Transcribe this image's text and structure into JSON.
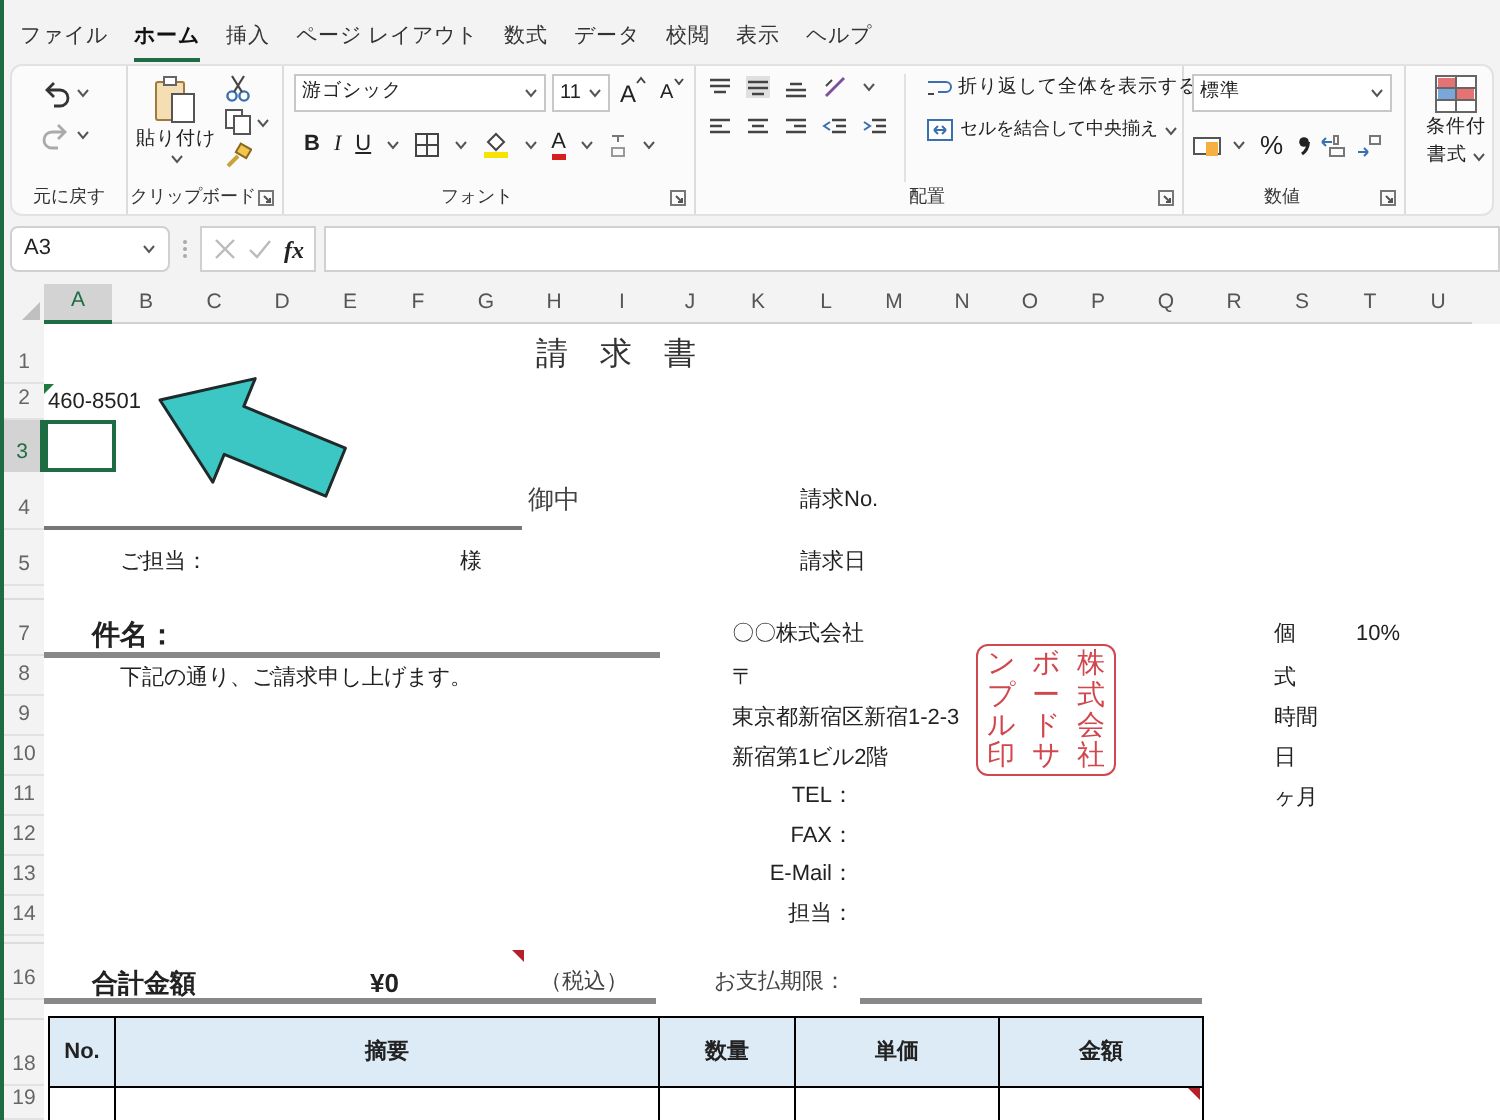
{
  "tabs": [
    {
      "label": "ファイル",
      "selected": false
    },
    {
      "label": "ホーム",
      "selected": true
    },
    {
      "label": "挿入",
      "selected": false
    },
    {
      "label": "ページ レイアウト",
      "selected": false
    },
    {
      "label": "数式",
      "selected": false
    },
    {
      "label": "データ",
      "selected": false
    },
    {
      "label": "校閲",
      "selected": false
    },
    {
      "label": "表示",
      "selected": false
    },
    {
      "label": "ヘルプ",
      "selected": false
    }
  ],
  "ribbon": {
    "undo_group": {
      "label": "元に戻す"
    },
    "clipboard_group": {
      "label": "クリップボード",
      "paste": "貼り付け"
    },
    "font_group": {
      "label": "フォント",
      "font_name": "游ゴシック",
      "font_size": "11",
      "grow_font": "A",
      "shrink_font": "A",
      "bold": "B",
      "italic": "I",
      "underline": "U",
      "font_color": "A"
    },
    "alignment_group": {
      "label": "配置",
      "wrap_text": "折り返して全体を表示する",
      "merge_center": "セルを結合して中央揃え"
    },
    "number_group": {
      "label": "数値",
      "number_format": "標準",
      "percent": "%"
    },
    "styles_group": {
      "conditional_format": "条件付",
      "format": "書式"
    }
  },
  "formula_bar": {
    "name_box": "A3",
    "fx": "fx"
  },
  "column_headers": [
    {
      "label": "A",
      "selected": true
    },
    {
      "label": "B",
      "selected": false
    },
    {
      "label": "C",
      "selected": false
    },
    {
      "label": "D",
      "selected": false
    },
    {
      "label": "E",
      "selected": false
    },
    {
      "label": "F",
      "selected": false
    },
    {
      "label": "G",
      "selected": false
    },
    {
      "label": "H",
      "selected": false
    },
    {
      "label": "I",
      "selected": false
    },
    {
      "label": "J",
      "selected": false
    },
    {
      "label": "K",
      "selected": false
    },
    {
      "label": "L",
      "selected": false
    },
    {
      "label": "M",
      "selected": false
    },
    {
      "label": "N",
      "selected": false
    },
    {
      "label": "O",
      "selected": false
    },
    {
      "label": "P",
      "selected": false
    },
    {
      "label": "Q",
      "selected": false
    },
    {
      "label": "R",
      "selected": false
    },
    {
      "label": "S",
      "selected": false
    },
    {
      "label": "T",
      "selected": false
    },
    {
      "label": "U",
      "selected": false
    }
  ],
  "row_headers": [
    {
      "label": "1",
      "selected": false
    },
    {
      "label": "2",
      "selected": false
    },
    {
      "label": "3",
      "selected": true
    },
    {
      "label": "4",
      "selected": false
    },
    {
      "label": "5",
      "selected": false
    },
    {
      "label": "7",
      "selected": false
    },
    {
      "label": "8",
      "selected": false
    },
    {
      "label": "9",
      "selected": false
    },
    {
      "label": "10",
      "selected": false
    },
    {
      "label": "11",
      "selected": false
    },
    {
      "label": "12",
      "selected": false
    },
    {
      "label": "13",
      "selected": false
    },
    {
      "label": "14",
      "selected": false
    },
    {
      "label": "16",
      "selected": false
    },
    {
      "label": "18",
      "selected": false
    },
    {
      "label": "19",
      "selected": false
    }
  ],
  "sheet": {
    "title": "請　求　書",
    "postal_code": "460-8501",
    "addressee_suffix": "御中",
    "invoice_no_label": "請求No.",
    "contact_label": "ご担当：",
    "contact_suffix": "様",
    "invoice_date_label": "請求日",
    "subject_label": "件名：",
    "greeting": "下記の通り、ご請求申し上げます。",
    "issuer_lines": [
      "〇〇株式会社",
      "〒",
      "東京都新宿区新宿1-2-3",
      "新宿第1ビル2階"
    ],
    "issuer_fields": [
      "TEL：",
      "FAX：",
      "E-Mail：",
      "担当："
    ],
    "units": [
      "個",
      "式",
      "時間",
      "日",
      "ヶ月"
    ],
    "tax_rate": "10%",
    "stamp_columns": [
      "ンプル印",
      "ボードサ",
      "株式会社"
    ],
    "total_label": "合計金額",
    "total_value": "¥0",
    "tax_note": "（税込）",
    "due_label": "お支払期限：",
    "table_columns": [
      "No.",
      "摘要",
      "数量",
      "単価",
      "金額"
    ]
  }
}
